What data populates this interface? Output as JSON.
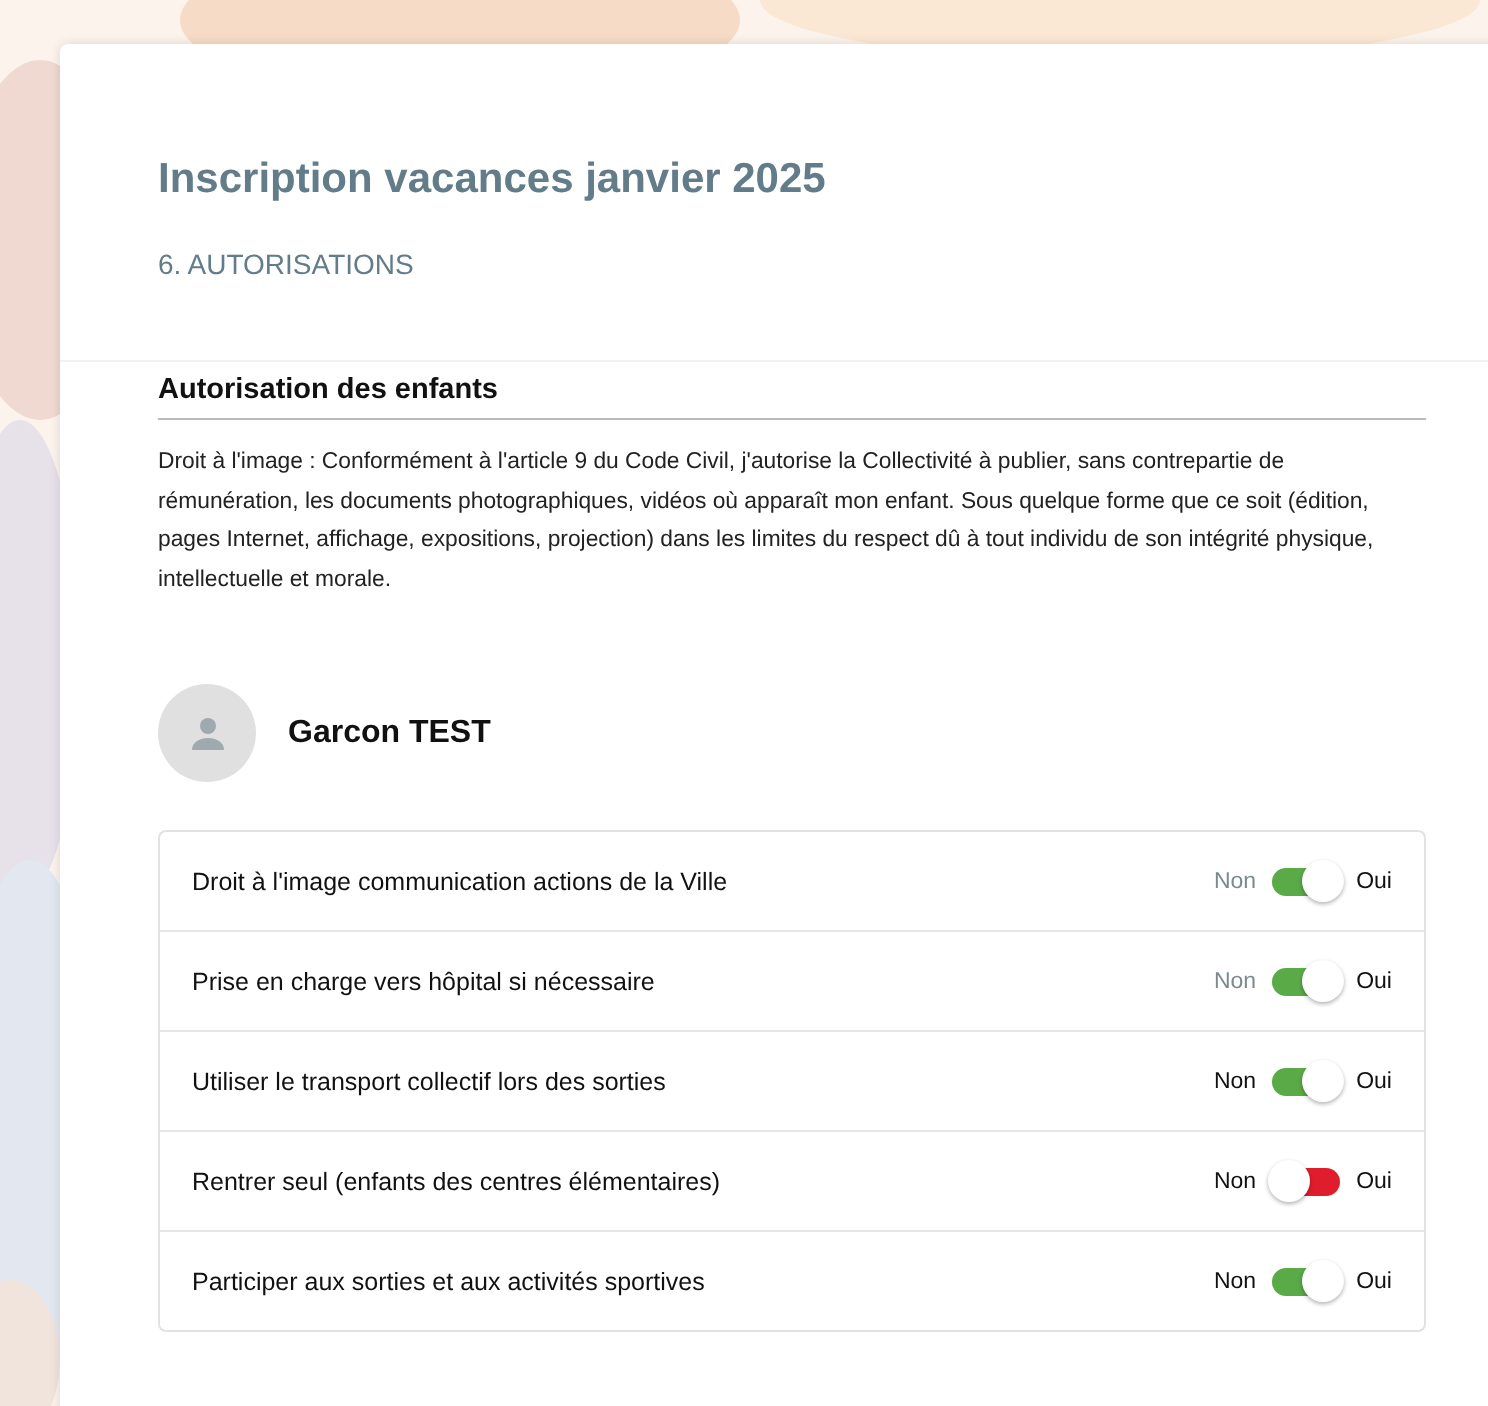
{
  "page": {
    "title": "Inscription vacances janvier 2025",
    "step": "6. AUTORISATIONS"
  },
  "section": {
    "heading": "Autorisation des enfants",
    "text": "Droit à l'image : Conformément à l'article 9 du Code Civil, j'autorise la Collectivité à publier, sans contrepartie de rémunération, les documents photographiques, vidéos où apparaît mon enfant. Sous quelque forme que ce soit (édition, pages Internet, affichage, expositions, projection) dans les limites du respect dû à tout individu de son intégrité physique, intellectuelle et morale."
  },
  "child": {
    "name": "Garcon TEST"
  },
  "authorizations": [
    {
      "label": "Droit à l'image communication actions de la Ville",
      "off_label": "Non",
      "on_label": "Oui",
      "on": true,
      "off_label_greyed": true
    },
    {
      "label": "Prise en charge vers hôpital si nécessaire",
      "off_label": "Non",
      "on_label": "Oui",
      "on": true,
      "off_label_greyed": true
    },
    {
      "label": "Utiliser le transport collectif lors des sorties",
      "off_label": "Non",
      "on_label": "Oui",
      "on": true,
      "off_label_greyed": false
    },
    {
      "label": "Rentrer seul (enfants des centres élémentaires)",
      "off_label": "Non",
      "on_label": "Oui",
      "on": false,
      "off_label_greyed": false
    },
    {
      "label": "Participer aux sorties et aux activités sportives",
      "off_label": "Non",
      "on_label": "Oui",
      "on": true,
      "off_label_greyed": false
    }
  ]
}
